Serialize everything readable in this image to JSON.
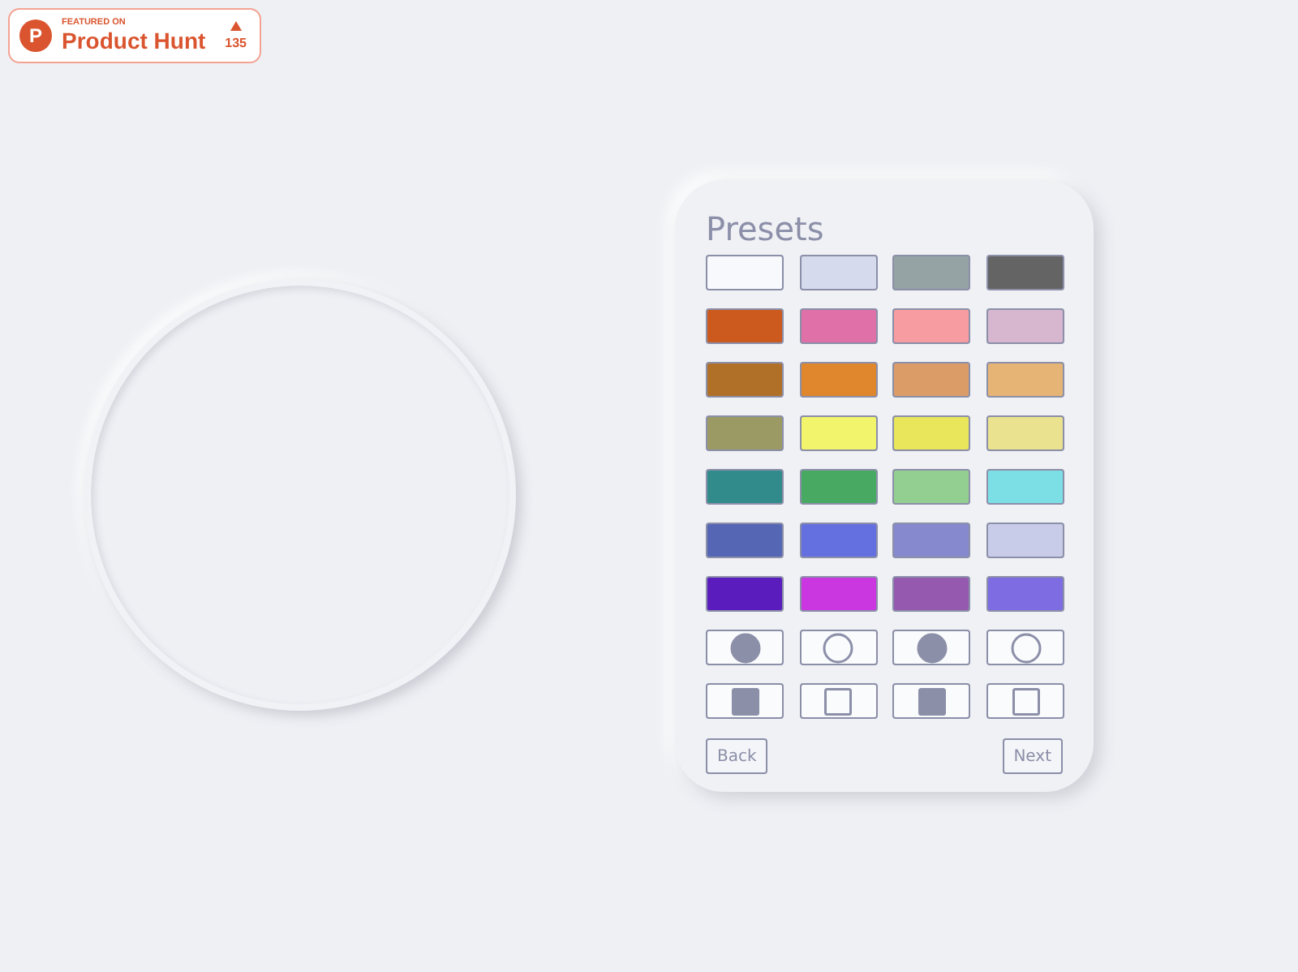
{
  "badge": {
    "logo_letter": "P",
    "caption": "FEATURED ON",
    "name": "Product Hunt",
    "votes": "135"
  },
  "panel": {
    "title": "Presets",
    "swatches": [
      {
        "kind": "color",
        "color": "#f8f9fc"
      },
      {
        "kind": "color",
        "color": "#d5daec"
      },
      {
        "kind": "color",
        "color": "#95a3a4"
      },
      {
        "kind": "color",
        "color": "#646464"
      },
      {
        "kind": "color",
        "color": "#cc5a1e"
      },
      {
        "kind": "color",
        "color": "#e070a8"
      },
      {
        "kind": "color",
        "color": "#f79ca0"
      },
      {
        "kind": "color",
        "color": "#d7b6d0"
      },
      {
        "kind": "color",
        "color": "#b07028"
      },
      {
        "kind": "color",
        "color": "#e0862c"
      },
      {
        "kind": "color",
        "color": "#dc9c68"
      },
      {
        "kind": "color",
        "color": "#e6b474"
      },
      {
        "kind": "color",
        "color": "#9c9a64"
      },
      {
        "kind": "color",
        "color": "#f2f46c"
      },
      {
        "kind": "color",
        "color": "#eae65c"
      },
      {
        "kind": "color",
        "color": "#eae28e"
      },
      {
        "kind": "color",
        "color": "#318b8a"
      },
      {
        "kind": "color",
        "color": "#48aa62"
      },
      {
        "kind": "color",
        "color": "#94cf92"
      },
      {
        "kind": "color",
        "color": "#7cdfe6"
      },
      {
        "kind": "color",
        "color": "#5566b5"
      },
      {
        "kind": "color",
        "color": "#6470e0"
      },
      {
        "kind": "color",
        "color": "#8689ce"
      },
      {
        "kind": "color",
        "color": "#c8cce8"
      },
      {
        "kind": "color",
        "color": "#5a1cbc"
      },
      {
        "kind": "color",
        "color": "#ca36e0"
      },
      {
        "kind": "color",
        "color": "#955ab0"
      },
      {
        "kind": "color",
        "color": "#7e6ce2"
      },
      {
        "kind": "circle",
        "filled": true
      },
      {
        "kind": "circle",
        "filled": false
      },
      {
        "kind": "circle",
        "filled": true
      },
      {
        "kind": "circle",
        "filled": false
      },
      {
        "kind": "square",
        "filled": true
      },
      {
        "kind": "square",
        "filled": false
      },
      {
        "kind": "square",
        "filled": true
      },
      {
        "kind": "square",
        "filled": false
      }
    ],
    "buttons": [
      "Back",
      "Next"
    ]
  }
}
